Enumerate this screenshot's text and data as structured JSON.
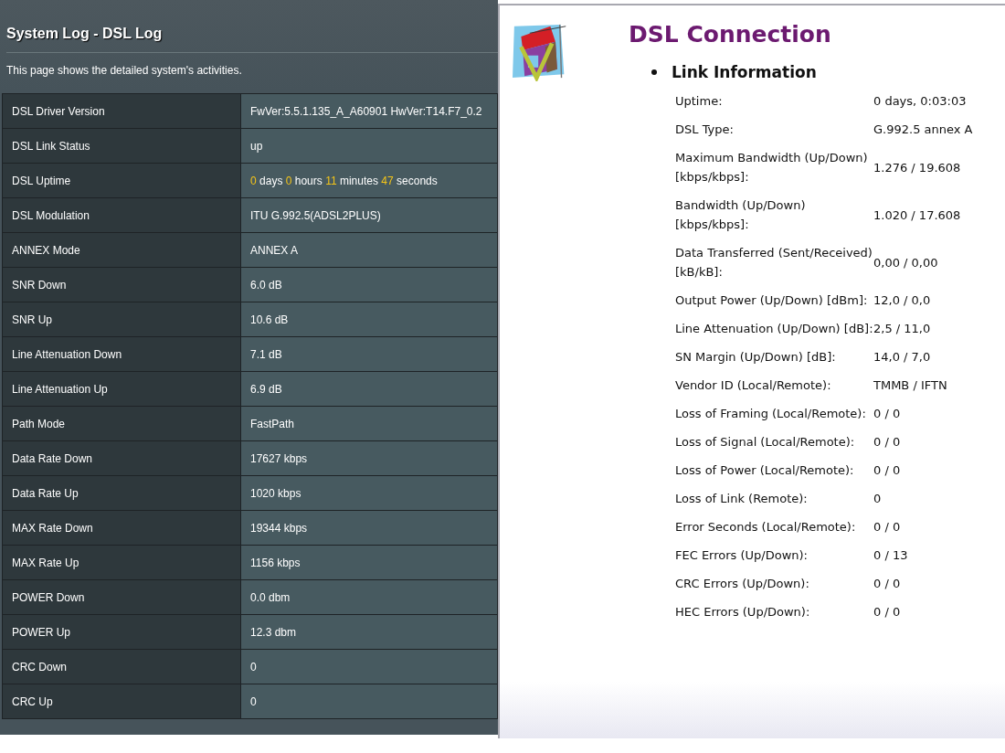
{
  "system_log": {
    "title": "System Log - DSL Log",
    "description": "This page shows the detailed system's activities.",
    "rows": [
      {
        "kind": "plain",
        "label": "DSL Driver Version",
        "value": "FwVer:5.5.1.135_A_A60901 HwVer:T14.F7_0.2"
      },
      {
        "kind": "plain",
        "label": "DSL Link Status",
        "value": "up"
      },
      {
        "kind": "parts",
        "label": "DSL Uptime",
        "parts": [
          {
            "text": "0",
            "highlight": true
          },
          {
            "text": "days",
            "highlight": false
          },
          {
            "text": "0",
            "highlight": true
          },
          {
            "text": "hours",
            "highlight": false
          },
          {
            "text": "11",
            "highlight": true
          },
          {
            "text": "minutes",
            "highlight": false
          },
          {
            "text": "47",
            "highlight": true
          },
          {
            "text": "seconds",
            "highlight": false
          }
        ]
      },
      {
        "kind": "plain",
        "label": "DSL Modulation",
        "value": "ITU G.992.5(ADSL2PLUS)"
      },
      {
        "kind": "plain",
        "label": "ANNEX Mode",
        "value": "ANNEX A"
      },
      {
        "kind": "plain",
        "label": "SNR Down",
        "value": "6.0 dB"
      },
      {
        "kind": "plain",
        "label": "SNR Up",
        "value": "10.6 dB"
      },
      {
        "kind": "plain",
        "label": "Line Attenuation Down",
        "value": "7.1 dB"
      },
      {
        "kind": "plain",
        "label": "Line Attenuation Up",
        "value": "6.9 dB"
      },
      {
        "kind": "plain",
        "label": "Path Mode",
        "value": "FastPath"
      },
      {
        "kind": "plain",
        "label": "Data Rate Down",
        "value": "17627 kbps"
      },
      {
        "kind": "plain",
        "label": "Data Rate Up",
        "value": "1020 kbps"
      },
      {
        "kind": "plain",
        "label": "MAX Rate Down",
        "value": "19344 kbps"
      },
      {
        "kind": "plain",
        "label": "MAX Rate Up",
        "value": "1156 kbps"
      },
      {
        "kind": "plain",
        "label": "POWER Down",
        "value": "0.0 dbm"
      },
      {
        "kind": "plain",
        "label": "POWER Up",
        "value": "12.3 dbm"
      },
      {
        "kind": "plain",
        "label": "CRC Down",
        "value": "0"
      },
      {
        "kind": "plain",
        "label": "CRC Up",
        "value": "0"
      }
    ]
  },
  "dsl_connection": {
    "title": "DSL Connection",
    "section": "Link Information",
    "items": [
      {
        "label": "Uptime:",
        "value": "0 days, 0:03:03"
      },
      {
        "label": "DSL Type:",
        "value": "G.992.5 annex A"
      },
      {
        "label": "Maximum Bandwidth (Up/Down) [kbps/kbps]:",
        "value": "1.276 / 19.608"
      },
      {
        "label": "Bandwidth (Up/Down) [kbps/kbps]:",
        "value": "1.020 / 17.608"
      },
      {
        "label": "Data Transferred (Sent/Received) [kB/kB]:",
        "value": "0,00 / 0,00"
      },
      {
        "label": "Output Power (Up/Down) [dBm]:",
        "value": "12,0 / 0,0"
      },
      {
        "label": "Line Attenuation (Up/Down) [dB]:",
        "value": "2,5 / 11,0"
      },
      {
        "label": "SN Margin (Up/Down) [dB]:",
        "value": "14,0 / 7,0"
      },
      {
        "label": "Vendor ID (Local/Remote):",
        "value": "TMMB / IFTN"
      },
      {
        "label": "Loss of Framing (Local/Remote):",
        "value": "0 / 0"
      },
      {
        "label": "Loss of Signal (Local/Remote):",
        "value": "0 / 0"
      },
      {
        "label": "Loss of Power (Local/Remote):",
        "value": "0 / 0"
      },
      {
        "label": "Loss of Link (Remote):",
        "value": "0"
      },
      {
        "label": "Error Seconds (Local/Remote):",
        "value": "0 / 0"
      },
      {
        "label": "FEC Errors (Up/Down):",
        "value": "0 / 13"
      },
      {
        "label": "CRC Errors (Up/Down):",
        "value": "0 / 0"
      },
      {
        "label": "HEC Errors (Up/Down):",
        "value": "0 / 0"
      }
    ]
  }
}
